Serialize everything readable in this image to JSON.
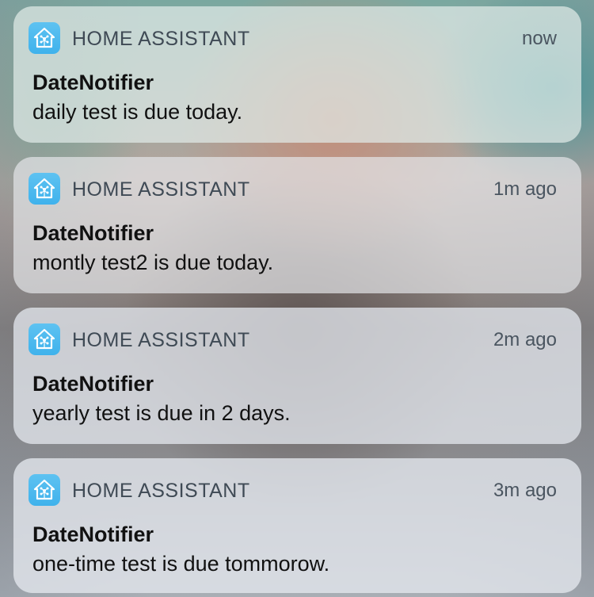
{
  "notifications": [
    {
      "app_name": "HOME ASSISTANT",
      "time": "now",
      "title": "DateNotifier",
      "body": "daily test is due today.",
      "icon": "home-assistant-icon"
    },
    {
      "app_name": "HOME ASSISTANT",
      "time": "1m ago",
      "title": "DateNotifier",
      "body": "montly test2 is due today.",
      "icon": "home-assistant-icon"
    },
    {
      "app_name": "HOME ASSISTANT",
      "time": "2m ago",
      "title": "DateNotifier",
      "body": "yearly test is due in 2 days.",
      "icon": "home-assistant-icon"
    },
    {
      "app_name": "HOME ASSISTANT",
      "time": "3m ago",
      "title": "DateNotifier",
      "body": "one-time test is due tommorow.",
      "icon": "home-assistant-icon"
    }
  ],
  "colors": {
    "app_icon_background": "#41b4ed",
    "app_icon_glyph": "#ffffff"
  }
}
